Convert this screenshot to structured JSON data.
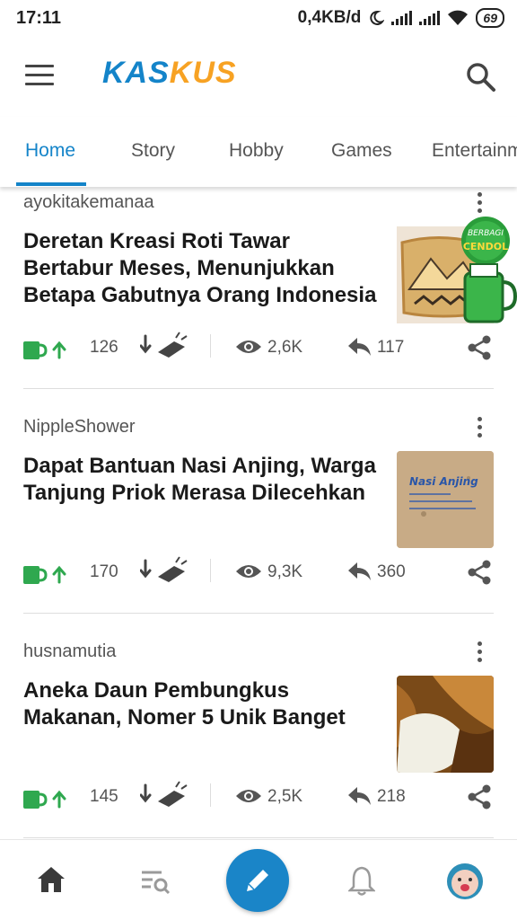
{
  "status_bar": {
    "time": "17:11",
    "speed": "0,4KB/d",
    "battery": "69"
  },
  "app_bar": {
    "logo_part1": "KAS",
    "logo_part2": "KUS",
    "brand_colors": {
      "blue": "#1484c9",
      "orange": "#f7a223"
    },
    "icons": {
      "menu": "hamburger-menu-icon",
      "search": "search-icon"
    }
  },
  "tabs": [
    {
      "label": "Home",
      "active": true
    },
    {
      "label": "Story",
      "active": false
    },
    {
      "label": "Hobby",
      "active": false
    },
    {
      "label": "Games",
      "active": false
    },
    {
      "label": "Entertainm",
      "active": false
    }
  ],
  "posts": [
    {
      "author": "ayokitakemanaa",
      "title": "Deretan Kreasi Roti Tawar Bertabur Meses, Menunjukkan Betapa Gabutnya Orang Indonesia",
      "upvotes": "126",
      "views": "2,6K",
      "replies": "117",
      "badge_line1": "BERBAGI",
      "badge_line2": "CENDOL"
    },
    {
      "author": "NippleShower",
      "title": "Dapat Bantuan Nasi Anjing, Warga Tanjung Priok Merasa Dilecehkan",
      "upvotes": "170",
      "views": "9,3K",
      "replies": "360",
      "thumb_text": "Nasi Anjing"
    },
    {
      "author": "husnamutia",
      "title": "Aneka Daun Pembungkus Makanan, Nomer 5 Unik Banget",
      "upvotes": "145",
      "views": "2,5K",
      "replies": "218"
    }
  ],
  "bottom_nav": {
    "items": [
      "home-icon",
      "feed-search-icon",
      "create-post-pencil-icon",
      "notification-bell-icon",
      "profile-avatar"
    ],
    "accent": "#1a85c8"
  }
}
